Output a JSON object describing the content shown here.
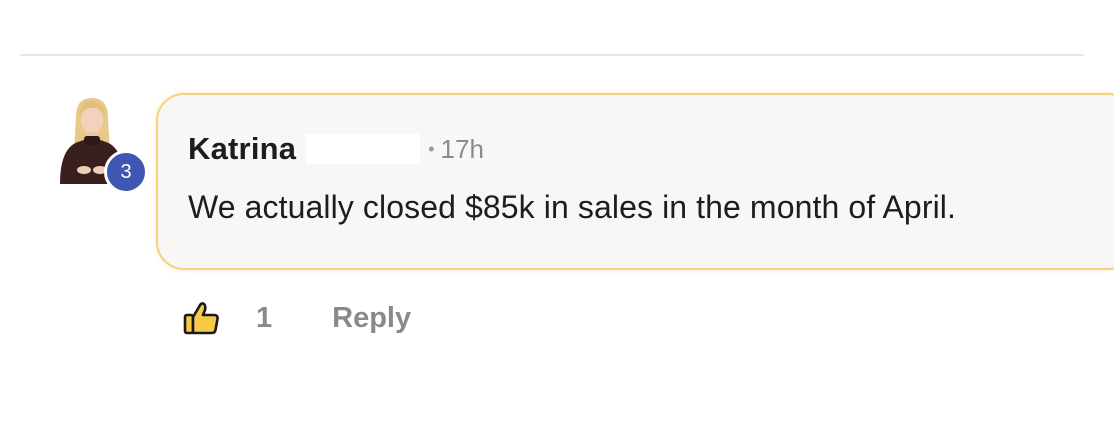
{
  "comment": {
    "author": "Katrina",
    "timestamp": "17h",
    "separator": "•",
    "text": "We actually closed $85k in sales in the month of April.",
    "level": "3",
    "like_count": "1",
    "reply_label": "Reply"
  },
  "icons": {
    "avatar": "user-avatar",
    "like": "thumbs-up-icon"
  },
  "colors": {
    "badge": "#4056b3",
    "bubble_border": "#f6d37a",
    "bubble_bg": "#f8f7f5",
    "like_fill": "#f7c948",
    "muted_text": "#8a8a8a"
  }
}
